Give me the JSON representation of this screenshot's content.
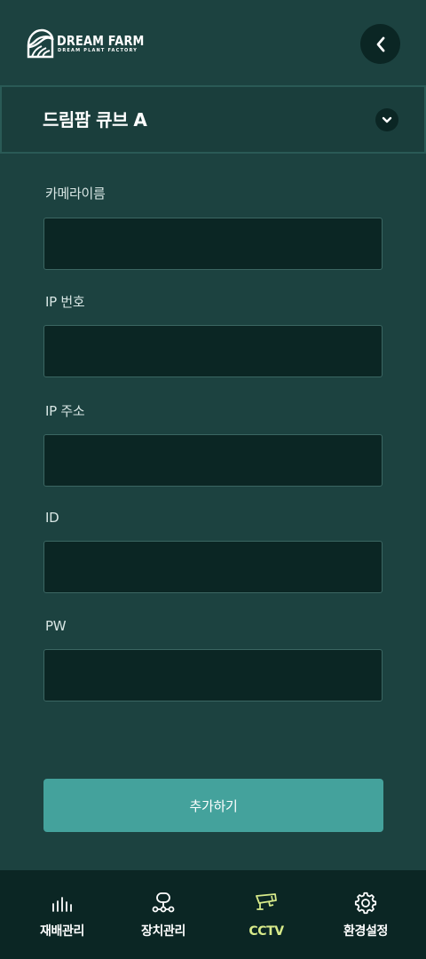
{
  "header": {
    "logo_title": "DREAM FARM",
    "logo_subtitle": "DREAM PLANT FACTORY",
    "back_icon": "chevron-left-icon"
  },
  "farm_selector": {
    "selected": "드림팜 큐브 A",
    "toggle_icon": "chevron-down-icon"
  },
  "form": {
    "fields": [
      {
        "label": "카메라이름",
        "value": ""
      },
      {
        "label": "IP 번호",
        "value": ""
      },
      {
        "label": "IP 주소",
        "value": ""
      },
      {
        "label": "ID",
        "value": ""
      },
      {
        "label": "PW",
        "value": ""
      }
    ],
    "submit_label": "추가하기"
  },
  "bottom_nav": {
    "active": "CCTV",
    "items": [
      {
        "label": "재배관리",
        "icon": "bar-chart-icon"
      },
      {
        "label": "장치관리",
        "icon": "device-network-icon"
      },
      {
        "label": "CCTV",
        "icon": "cctv-camera-icon"
      },
      {
        "label": "환경설정",
        "icon": "gear-icon"
      }
    ]
  },
  "colors": {
    "background": "#1c4240",
    "input_background": "#0b2624",
    "accent_button": "#44a29c",
    "active_nav": "#d7ea8a"
  }
}
